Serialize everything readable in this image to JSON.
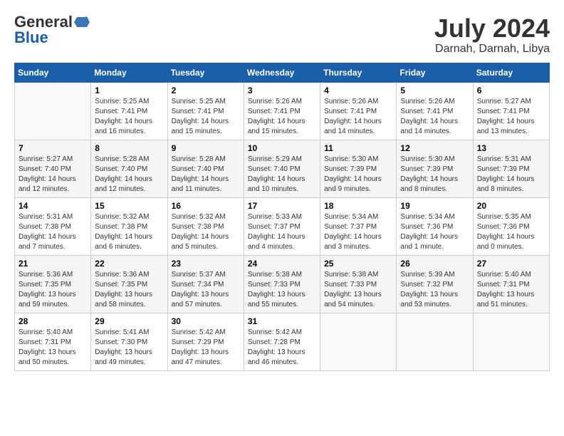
{
  "header": {
    "logo_general": "General",
    "logo_blue": "Blue",
    "month_year": "July 2024",
    "location": "Darnah, Darnah, Libya"
  },
  "weekdays": [
    "Sunday",
    "Monday",
    "Tuesday",
    "Wednesday",
    "Thursday",
    "Friday",
    "Saturday"
  ],
  "weeks": [
    [
      {
        "day": "",
        "info": ""
      },
      {
        "day": "1",
        "info": "Sunrise: 5:25 AM\nSunset: 7:41 PM\nDaylight: 14 hours\nand 16 minutes."
      },
      {
        "day": "2",
        "info": "Sunrise: 5:25 AM\nSunset: 7:41 PM\nDaylight: 14 hours\nand 15 minutes."
      },
      {
        "day": "3",
        "info": "Sunrise: 5:26 AM\nSunset: 7:41 PM\nDaylight: 14 hours\nand 15 minutes."
      },
      {
        "day": "4",
        "info": "Sunrise: 5:26 AM\nSunset: 7:41 PM\nDaylight: 14 hours\nand 14 minutes."
      },
      {
        "day": "5",
        "info": "Sunrise: 5:26 AM\nSunset: 7:41 PM\nDaylight: 14 hours\nand 14 minutes."
      },
      {
        "day": "6",
        "info": "Sunrise: 5:27 AM\nSunset: 7:41 PM\nDaylight: 14 hours\nand 13 minutes."
      }
    ],
    [
      {
        "day": "7",
        "info": "Sunrise: 5:27 AM\nSunset: 7:40 PM\nDaylight: 14 hours\nand 12 minutes."
      },
      {
        "day": "8",
        "info": "Sunrise: 5:28 AM\nSunset: 7:40 PM\nDaylight: 14 hours\nand 12 minutes."
      },
      {
        "day": "9",
        "info": "Sunrise: 5:28 AM\nSunset: 7:40 PM\nDaylight: 14 hours\nand 11 minutes."
      },
      {
        "day": "10",
        "info": "Sunrise: 5:29 AM\nSunset: 7:40 PM\nDaylight: 14 hours\nand 10 minutes."
      },
      {
        "day": "11",
        "info": "Sunrise: 5:30 AM\nSunset: 7:39 PM\nDaylight: 14 hours\nand 9 minutes."
      },
      {
        "day": "12",
        "info": "Sunrise: 5:30 AM\nSunset: 7:39 PM\nDaylight: 14 hours\nand 8 minutes."
      },
      {
        "day": "13",
        "info": "Sunrise: 5:31 AM\nSunset: 7:39 PM\nDaylight: 14 hours\nand 8 minutes."
      }
    ],
    [
      {
        "day": "14",
        "info": "Sunrise: 5:31 AM\nSunset: 7:38 PM\nDaylight: 14 hours\nand 7 minutes."
      },
      {
        "day": "15",
        "info": "Sunrise: 5:32 AM\nSunset: 7:38 PM\nDaylight: 14 hours\nand 6 minutes."
      },
      {
        "day": "16",
        "info": "Sunrise: 5:32 AM\nSunset: 7:38 PM\nDaylight: 14 hours\nand 5 minutes."
      },
      {
        "day": "17",
        "info": "Sunrise: 5:33 AM\nSunset: 7:37 PM\nDaylight: 14 hours\nand 4 minutes."
      },
      {
        "day": "18",
        "info": "Sunrise: 5:34 AM\nSunset: 7:37 PM\nDaylight: 14 hours\nand 3 minutes."
      },
      {
        "day": "19",
        "info": "Sunrise: 5:34 AM\nSunset: 7:36 PM\nDaylight: 14 hours\nand 1 minute."
      },
      {
        "day": "20",
        "info": "Sunrise: 5:35 AM\nSunset: 7:36 PM\nDaylight: 14 hours\nand 0 minutes."
      }
    ],
    [
      {
        "day": "21",
        "info": "Sunrise: 5:36 AM\nSunset: 7:35 PM\nDaylight: 13 hours\nand 59 minutes."
      },
      {
        "day": "22",
        "info": "Sunrise: 5:36 AM\nSunset: 7:35 PM\nDaylight: 13 hours\nand 58 minutes."
      },
      {
        "day": "23",
        "info": "Sunrise: 5:37 AM\nSunset: 7:34 PM\nDaylight: 13 hours\nand 57 minutes."
      },
      {
        "day": "24",
        "info": "Sunrise: 5:38 AM\nSunset: 7:33 PM\nDaylight: 13 hours\nand 55 minutes."
      },
      {
        "day": "25",
        "info": "Sunrise: 5:38 AM\nSunset: 7:33 PM\nDaylight: 13 hours\nand 54 minutes."
      },
      {
        "day": "26",
        "info": "Sunrise: 5:39 AM\nSunset: 7:32 PM\nDaylight: 13 hours\nand 53 minutes."
      },
      {
        "day": "27",
        "info": "Sunrise: 5:40 AM\nSunset: 7:31 PM\nDaylight: 13 hours\nand 51 minutes."
      }
    ],
    [
      {
        "day": "28",
        "info": "Sunrise: 5:40 AM\nSunset: 7:31 PM\nDaylight: 13 hours\nand 50 minutes."
      },
      {
        "day": "29",
        "info": "Sunrise: 5:41 AM\nSunset: 7:30 PM\nDaylight: 13 hours\nand 49 minutes."
      },
      {
        "day": "30",
        "info": "Sunrise: 5:42 AM\nSunset: 7:29 PM\nDaylight: 13 hours\nand 47 minutes."
      },
      {
        "day": "31",
        "info": "Sunrise: 5:42 AM\nSunset: 7:28 PM\nDaylight: 13 hours\nand 46 minutes."
      },
      {
        "day": "",
        "info": ""
      },
      {
        "day": "",
        "info": ""
      },
      {
        "day": "",
        "info": ""
      }
    ]
  ]
}
